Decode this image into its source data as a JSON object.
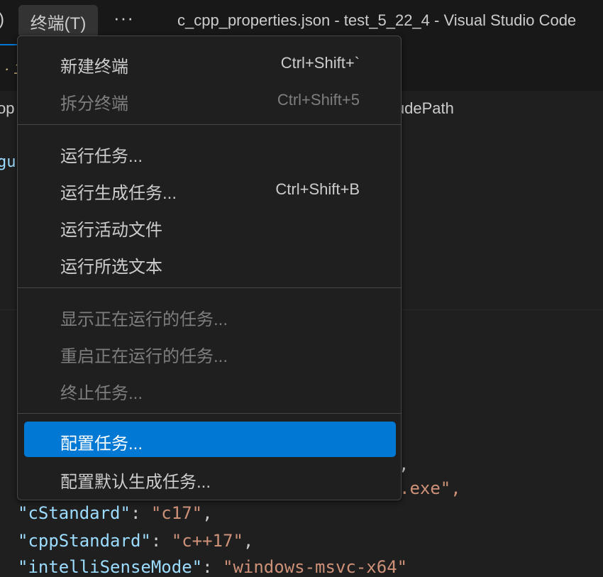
{
  "titlebar": {
    "paren_fragment": ")",
    "terminal_menu": "终端(T)",
    "more": "···",
    "window_title": "c_cpp_properties.json - test_5_22_4 - Visual Studio Code"
  },
  "editor_background": {
    "tab_fragment": "· 1",
    "breadcrumb_left_fragment": "op",
    "breadcrumb_right_fragment": "ludePath",
    "code_fragment_gu": "gu",
    "line_comma": ",",
    "line_exe": ".exe\",",
    "line_cstandard": {
      "key": "\"cStandard\"",
      "sep": ": ",
      "value": "\"c17\"",
      "end": ","
    },
    "line_cppstandard": {
      "key": "\"cppStandard\"",
      "sep": ": ",
      "value": "\"c++17\"",
      "end": ","
    },
    "line_intellisense": {
      "key": "\"intelliSenseMode\"",
      "sep": ": ",
      "value": "\"windows-msvc-x64\"",
      "end": ""
    }
  },
  "terminal_menu": {
    "items": [
      {
        "label": "新建终端",
        "shortcut": "Ctrl+Shift+`",
        "disabled": false
      },
      {
        "label": "拆分终端",
        "shortcut": "Ctrl+Shift+5",
        "disabled": true
      },
      {
        "label": "运行任务...",
        "shortcut": "",
        "disabled": false
      },
      {
        "label": "运行生成任务...",
        "shortcut": "Ctrl+Shift+B",
        "disabled": false
      },
      {
        "label": "运行活动文件",
        "shortcut": "",
        "disabled": false
      },
      {
        "label": "运行所选文本",
        "shortcut": "",
        "disabled": false
      },
      {
        "label": "显示正在运行的任务...",
        "shortcut": "",
        "disabled": true
      },
      {
        "label": "重启正在运行的任务...",
        "shortcut": "",
        "disabled": true
      },
      {
        "label": "终止任务...",
        "shortcut": "",
        "disabled": true
      },
      {
        "label": "配置任务...",
        "shortcut": "",
        "disabled": false,
        "selected": true
      },
      {
        "label": "配置默认生成任务...",
        "shortcut": "",
        "disabled": false
      }
    ]
  },
  "colors": {
    "accent": "#0078d4",
    "json_key": "#9cdcfe",
    "json_string": "#ce9178"
  }
}
